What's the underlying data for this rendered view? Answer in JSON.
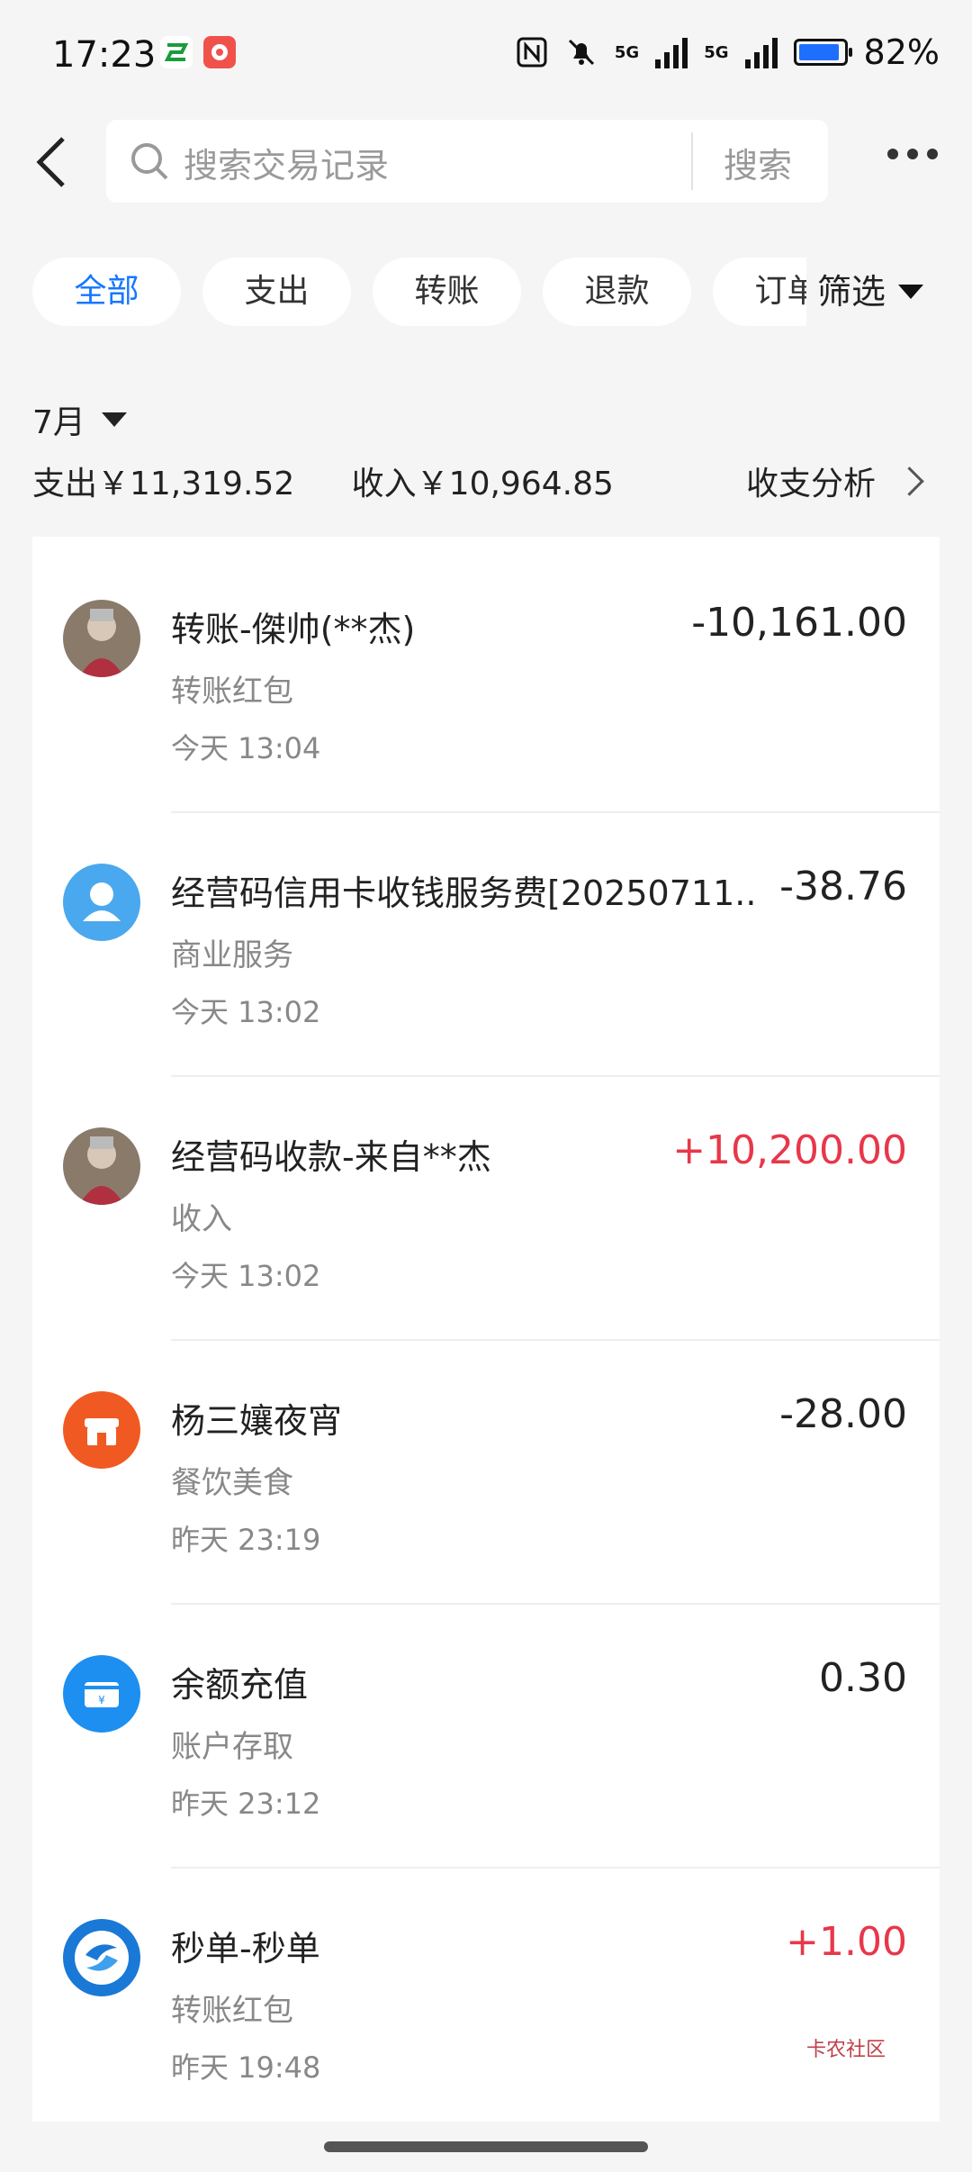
{
  "status_bar": {
    "time": "17:23",
    "battery": "82%",
    "network_1": "5G",
    "network_2": "5G"
  },
  "search": {
    "placeholder": "搜索交易记录",
    "button": "搜索"
  },
  "filters": [
    "全部",
    "支出",
    "转账",
    "退款",
    "订单"
  ],
  "filter_button": "筛选",
  "month": "7月",
  "summary": {
    "expense": "支出￥11,319.52",
    "income": "收入￥10,964.85",
    "analysis": "收支分析"
  },
  "transactions": [
    {
      "title": "转账-傑帅(**杰)",
      "category": "转账红包",
      "time": "今天 13:04",
      "amount": "-10,161.00",
      "positive": false,
      "icon": "person-photo-icon"
    },
    {
      "title": "经营码信用卡收钱服务费[20250711...",
      "category": "商业服务",
      "time": "今天 13:02",
      "amount": "-38.76",
      "positive": false,
      "icon": "user-icon"
    },
    {
      "title": "经营码收款-来自**杰",
      "category": "收入",
      "time": "今天 13:02",
      "amount": "+10,200.00",
      "positive": true,
      "icon": "person-photo-icon"
    },
    {
      "title": "杨三孃夜宵",
      "category": "餐饮美食",
      "time": "昨天 23:19",
      "amount": "-28.00",
      "positive": false,
      "icon": "store-icon"
    },
    {
      "title": "余额充值",
      "category": "账户存取",
      "time": "昨天 23:12",
      "amount": "0.30",
      "positive": false,
      "icon": "wallet-icon"
    },
    {
      "title": "秒单-秒单",
      "category": "转账红包",
      "time": "昨天 19:48",
      "amount": "+1.00",
      "positive": true,
      "icon": "swirl-logo-icon"
    }
  ],
  "watermark": "卡农社区",
  "colors": {
    "accent": "#1677ff",
    "positive": "#e8374a",
    "store": "#f05a22",
    "user": "#4aa8ee",
    "wallet": "#1c8ff0"
  }
}
